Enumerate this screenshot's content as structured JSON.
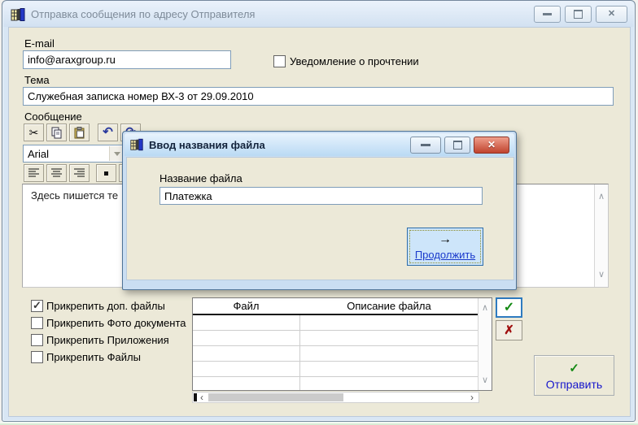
{
  "main_window": {
    "title": "Отправка сообщения по адресу Отправителя",
    "email": {
      "label": "E-mail",
      "value": "info@araxgroup.ru"
    },
    "read_receipt": {
      "label": "Уведомление о прочтении",
      "checked": false
    },
    "subject": {
      "label": "Тема",
      "value": "Служебная записка номер ВХ-3 от 29.09.2010"
    },
    "message": {
      "label": "Сообщение",
      "font_name": "Arial",
      "text": "Здесь пишется те"
    },
    "attachments": {
      "checkboxes": [
        {
          "label": "Прикрепить доп. файлы",
          "checked": true
        },
        {
          "label": "Прикрепить Фото документа",
          "checked": false
        },
        {
          "label": "Прикрепить Приложения",
          "checked": false
        },
        {
          "label": "Прикрепить Файлы",
          "checked": false
        }
      ],
      "table": {
        "columns": [
          "Файл",
          "Описание файла"
        ],
        "rows": []
      }
    },
    "send_button": {
      "label": "Отправить"
    }
  },
  "dialog": {
    "title": "Ввод названия файла",
    "filename": {
      "label": "Название файла",
      "value": "Платежка"
    },
    "continue_button": {
      "label": "Продолжить"
    }
  },
  "icons": {
    "cut": "✂",
    "undo": "↶",
    "redo": "↷",
    "numbered_list": "①",
    "check": "✓",
    "cross_red": "✗",
    "close_x": "✕",
    "arrow_right": "→",
    "chev_up": "∧",
    "chev_down": "∨",
    "chev_left": "‹",
    "chev_right": "›"
  },
  "colors": {
    "client_bg": "#ece9d8",
    "titlebar_active_top": "#e8f3fd",
    "titlebar_inactive_top": "#eaf2fb",
    "close_red": "#c0432e",
    "ok_green": "#148a14",
    "cancel_red": "#a01010",
    "link_blue": "#1a3acc",
    "send_blue": "#1515cc",
    "focus_border_blue": "#2e7bc0"
  }
}
